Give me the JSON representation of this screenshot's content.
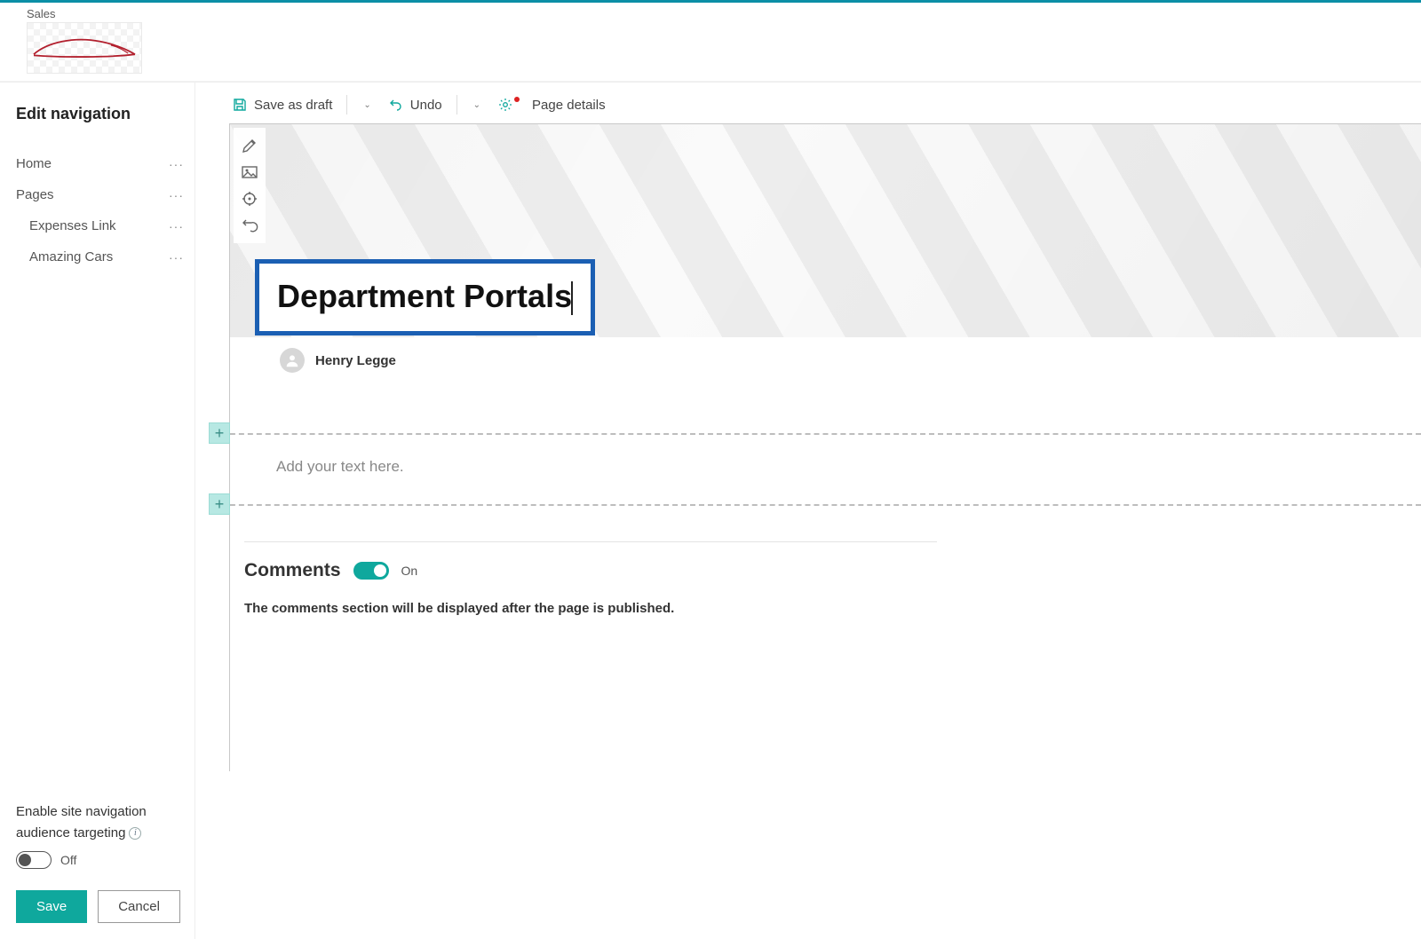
{
  "header": {
    "site_name": "Sales"
  },
  "sidebar": {
    "title": "Edit navigation",
    "items": [
      {
        "label": "Home",
        "sub": false
      },
      {
        "label": "Pages",
        "sub": false
      },
      {
        "label": "Expenses Link",
        "sub": true
      },
      {
        "label": "Amazing Cars",
        "sub": true
      }
    ],
    "audience_label_line1": "Enable site navigation",
    "audience_label_line2": "audience targeting",
    "toggle_state": "Off",
    "save_label": "Save",
    "cancel_label": "Cancel"
  },
  "toolbar": {
    "save_draft_label": "Save as draft",
    "undo_label": "Undo",
    "page_details_label": "Page details"
  },
  "page": {
    "title": "Department Portals",
    "author": "Henry Legge",
    "text_placeholder": "Add your text here."
  },
  "comments": {
    "title": "Comments",
    "state": "On",
    "note": "The comments section will be displayed after the page is published."
  },
  "colors": {
    "accent_teal": "#0fa89d",
    "highlight_blue": "#1b5fb3"
  }
}
